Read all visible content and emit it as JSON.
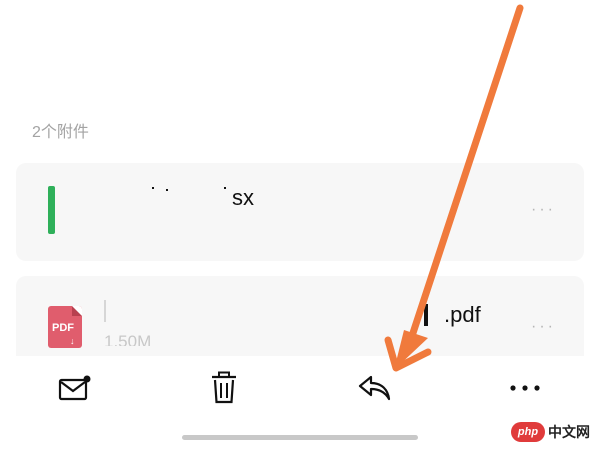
{
  "attachments": {
    "header": "2个附件",
    "items": [
      {
        "type": "xlsx",
        "name_visible": "sx",
        "more": "···"
      },
      {
        "type": "pdf",
        "name_visible": ".pdf",
        "size_visible": "1.50M",
        "icon_label": "PDF",
        "more": "···"
      }
    ]
  },
  "toolbar": {
    "mail": "mail-unread-icon",
    "delete": "trash-icon",
    "reply": "reply-icon",
    "more": "···"
  },
  "colors": {
    "xlsx": "#2fb05a",
    "pdf": "#e05d6d",
    "annotation_arrow": "#f07a3c",
    "card_bg": "#f7f7f7"
  },
  "watermark": {
    "logo": "php",
    "text": "中文网"
  }
}
